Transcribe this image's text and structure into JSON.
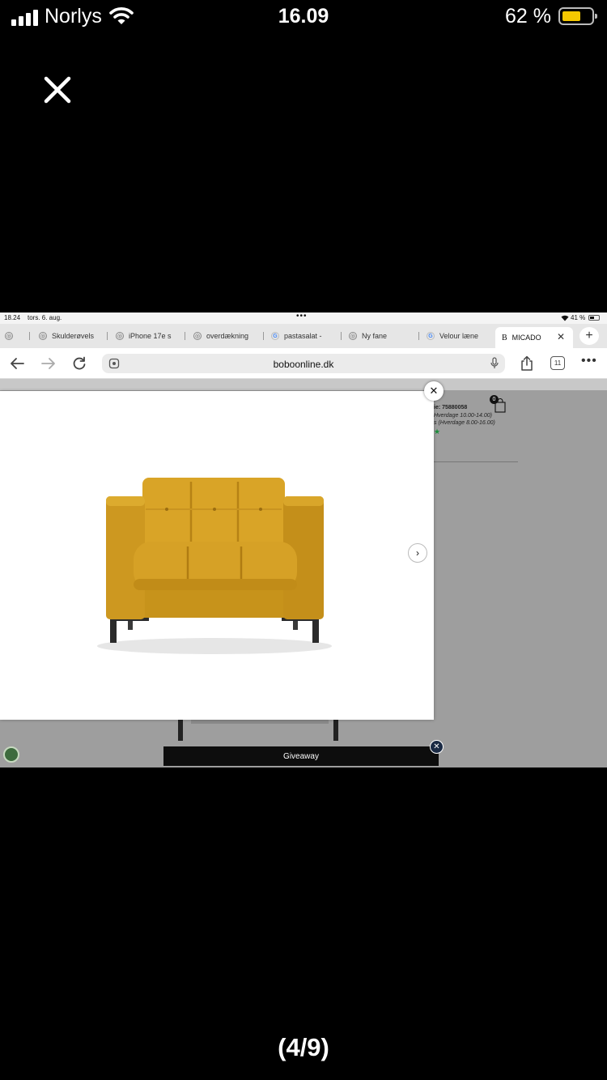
{
  "status_bar": {
    "carrier": "Norlys",
    "time": "16.09",
    "battery_percent": "62 %",
    "battery_color": "#f5c800"
  },
  "viewer": {
    "close_icon": "close-icon",
    "counter": "(4/9)"
  },
  "screenshot": {
    "ipad_status": {
      "time": "18.24",
      "date": "tors. 6. aug.",
      "battery": "41 %"
    },
    "tabs": [
      {
        "label": "Skulderøvels"
      },
      {
        "label": "iPhone 17e s"
      },
      {
        "label": "overdækning"
      },
      {
        "label": "pastasalat - "
      },
      {
        "label": "Ny fane"
      },
      {
        "label": "Velour læne"
      }
    ],
    "active_tab": {
      "icon_letter": "B",
      "label": "MICADO"
    },
    "address_bar": {
      "url": "boboonline.dk",
      "tabs_count": "11"
    },
    "page": {
      "product_code": "ie: 75880058",
      "hours_line_1": "Hverdage 10.00-14.00)",
      "hours_line_2": "s (Hverdage 8.00-16.00)",
      "cart_count": "0",
      "product_color": "#d4a023",
      "giveaway_label": "Giveaway"
    }
  }
}
